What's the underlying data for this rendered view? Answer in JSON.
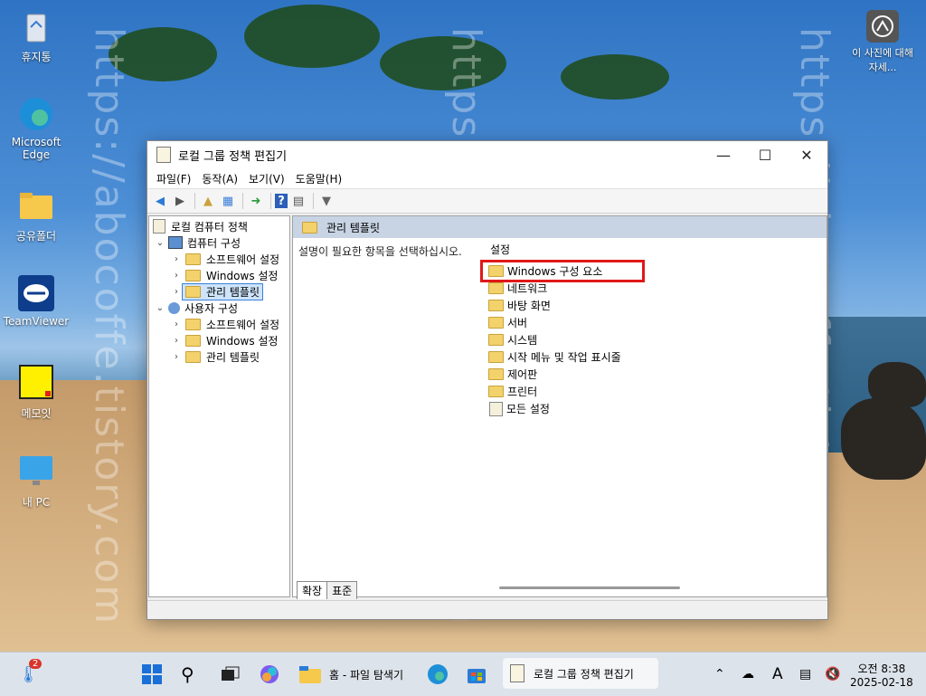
{
  "desktop": {
    "icons": [
      {
        "label": "휴지통"
      },
      {
        "label": "Microsoft Edge"
      },
      {
        "label": "공유폴더"
      },
      {
        "label": "TeamViewer"
      },
      {
        "label": "메모잇"
      },
      {
        "label": "내 PC"
      }
    ],
    "about_photo": "이 사진에 대해 자세...",
    "watermark": "https://abocoffe.tistory.com"
  },
  "window": {
    "title": "로컬 그룹 정책 편집기",
    "menu": [
      "파일(F)",
      "동작(A)",
      "보기(V)",
      "도움말(H)"
    ],
    "tree": {
      "root": "로컬 컴퓨터 정책",
      "computer": "컴퓨터 구성",
      "computer_children": [
        "소프트웨어 설정",
        "Windows 설정",
        "관리 템플릿"
      ],
      "user": "사용자 구성",
      "user_children": [
        "소프트웨어 설정",
        "Windows 설정",
        "관리 템플릿"
      ]
    },
    "panel_title": "관리 템플릿",
    "description": "설명이 필요한 항목을 선택하십시오.",
    "settings_header": "설정",
    "settings_items": [
      "Windows 구성 요소",
      "네트워크",
      "바탕 화면",
      "서버",
      "시스템",
      "시작 메뉴 및 작업 표시줄",
      "제어판",
      "프린터",
      "모든 설정"
    ],
    "tabs": [
      "확장",
      "표준"
    ]
  },
  "taskbar": {
    "weather_badge": "2",
    "file_explorer": "홈 - 파일 탐색기",
    "gpedit": "로컬 그룹 정책 편집기",
    "clock_time": "오전 8:38",
    "clock_date": "2025-02-18"
  }
}
